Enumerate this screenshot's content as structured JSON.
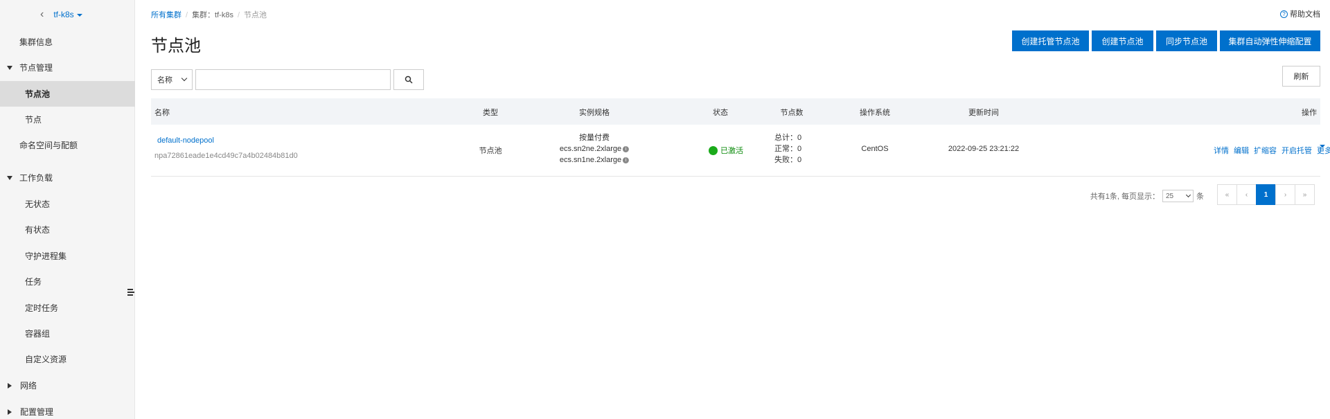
{
  "sidebar": {
    "cluster_name": "tf-k8s",
    "items": [
      {
        "label": "集群信息"
      },
      {
        "label": "节点管理"
      },
      {
        "label": "节点池"
      },
      {
        "label": "节点"
      },
      {
        "label": "命名空间与配额"
      },
      {
        "label": "工作负载"
      },
      {
        "label": "无状态"
      },
      {
        "label": "有状态"
      },
      {
        "label": "守护进程集"
      },
      {
        "label": "任务"
      },
      {
        "label": "定时任务"
      },
      {
        "label": "容器组"
      },
      {
        "label": "自定义资源"
      },
      {
        "label": "网络"
      },
      {
        "label": "配置管理"
      }
    ]
  },
  "breadcrumb": {
    "all_clusters": "所有集群",
    "cluster": "集群：tf-k8s",
    "current": "节点池"
  },
  "help": {
    "label": "帮助文档"
  },
  "page": {
    "title": "节点池"
  },
  "actions": {
    "create_managed": "创建托管节点池",
    "create": "创建节点池",
    "sync": "同步节点池",
    "autoscale": "集群自动弹性伸缩配置"
  },
  "filter": {
    "field": "名称",
    "placeholder": ""
  },
  "refresh": {
    "label": "刷新"
  },
  "table": {
    "columns": {
      "name": "名称",
      "type": "类型",
      "spec": "实例规格",
      "status": "状态",
      "nodes": "节点数",
      "os": "操作系统",
      "updated": "更新时间",
      "ops": "操作"
    },
    "rows": [
      {
        "name": "default-nodepool",
        "id": "npa72861eade1e4cd49c7a4b02484b81d0",
        "type": "节点池",
        "billing": "按量付费",
        "spec1": "ecs.sn2ne.2xlarge",
        "spec2": "ecs.sn1ne.2xlarge",
        "status": "已激活",
        "total": "总计：0",
        "normal": "正常：0",
        "failed": "失败：0",
        "os": "CentOS",
        "updated": "2022-09-25 23:21:22",
        "op_detail": "详情",
        "op_edit": "编辑",
        "op_scale": "扩缩容",
        "op_managed": "开启托管",
        "op_more": "更多"
      }
    ]
  },
  "pagination": {
    "summary": "共有1条, 每页显示：",
    "page_size": "25",
    "unit": "条",
    "first": "«",
    "prev": "‹",
    "current": "1",
    "next": "›",
    "last": "»"
  },
  "colors": {
    "primary": "#0070cc",
    "success": "#1aaa1a"
  }
}
